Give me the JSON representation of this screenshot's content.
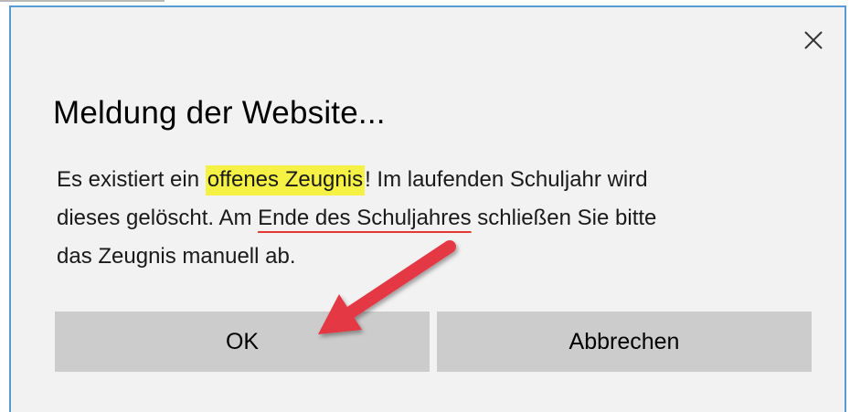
{
  "dialog": {
    "title": "Meldung der Website...",
    "close_icon": "close-icon",
    "message": {
      "line1_prefix": "Es existiert ein ",
      "line1_highlight": "offenes Zeugnis",
      "line1_suffix": "! Im laufenden Schuljahr wird",
      "line2_prefix": "dieses gelöscht. Am ",
      "line2_underlined": "Ende des Schuljahres",
      "line2_suffix": " schließen Sie bitte",
      "line3": "das Zeugnis manuell ab."
    },
    "buttons": {
      "ok_label": "OK",
      "cancel_label": "Abbrechen"
    }
  },
  "colors": {
    "dialog_border": "#5b9bd5",
    "dialog_background": "#f2f2f2",
    "button_background": "#cccccc",
    "highlight": "#f5f245",
    "annotation_red": "#e53945"
  }
}
